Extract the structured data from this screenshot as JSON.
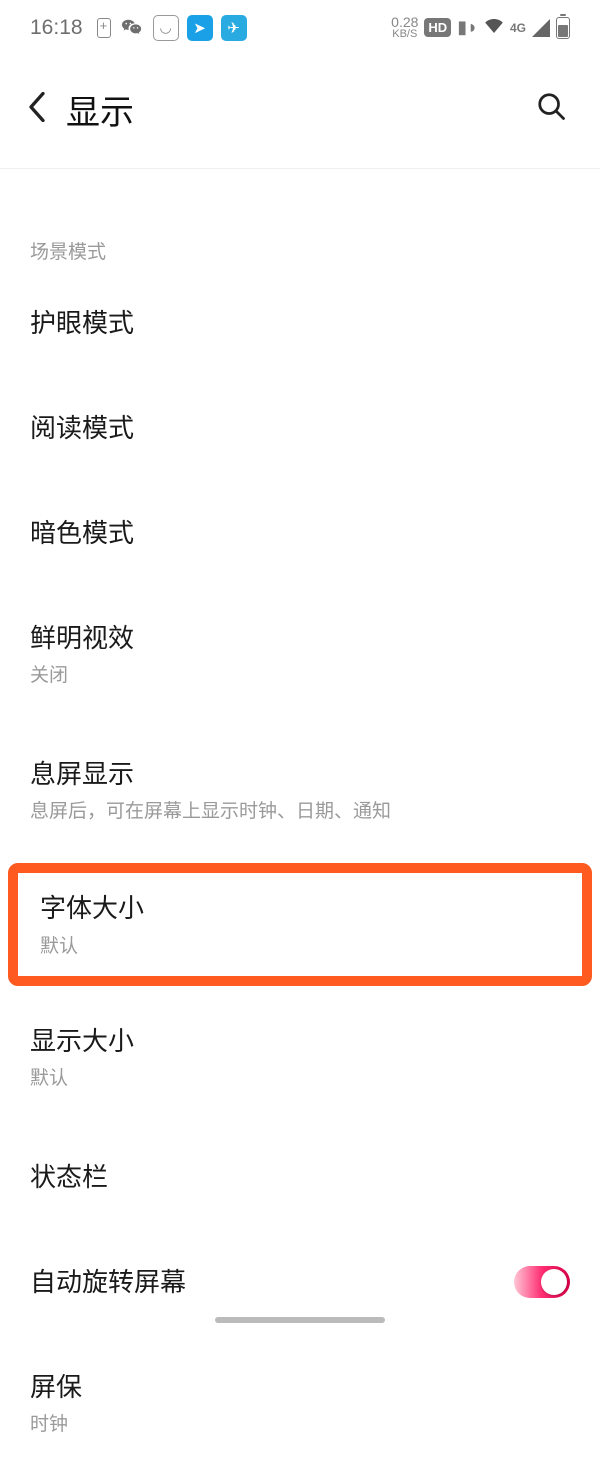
{
  "status_bar": {
    "time": "16:18",
    "net_speed_value": "0.28",
    "net_speed_unit": "KB/S",
    "hd": "HD",
    "net_type": "4G"
  },
  "header": {
    "title": "显示"
  },
  "section_label": "场景模式",
  "items": {
    "eye_protection": {
      "title": "护眼模式"
    },
    "reading_mode": {
      "title": "阅读模式"
    },
    "dark_mode": {
      "title": "暗色模式"
    },
    "vivid_effect": {
      "title": "鲜明视效",
      "sub": "关闭"
    },
    "aod": {
      "title": "息屏显示",
      "sub": "息屏后，可在屏幕上显示时钟、日期、通知"
    },
    "font_size": {
      "title": "字体大小",
      "sub": "默认"
    },
    "display_size": {
      "title": "显示大小",
      "sub": "默认"
    },
    "status_bar_item": {
      "title": "状态栏"
    },
    "auto_rotate": {
      "title": "自动旋转屏幕"
    },
    "screensaver": {
      "title": "屏保",
      "sub": "时钟"
    }
  }
}
